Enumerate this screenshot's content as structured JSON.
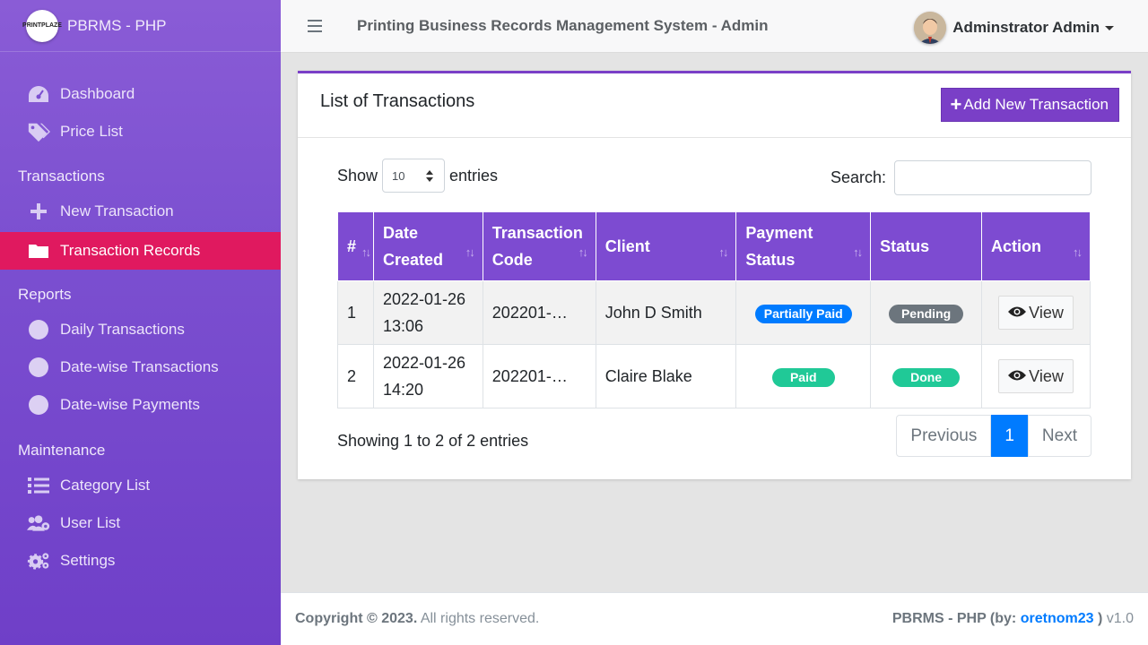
{
  "brand": {
    "name": "PBRMS - PHP",
    "logo_text": "PRINTPLAZE"
  },
  "sidebar": {
    "items": [
      {
        "label": "Dashboard",
        "icon": "tachometer-icon"
      },
      {
        "label": "Price List",
        "icon": "tags-icon"
      }
    ],
    "transactions_header": "Transactions",
    "transactions": [
      {
        "label": "New Transaction",
        "icon": "plus-icon"
      },
      {
        "label": "Transaction Records",
        "icon": "folder-icon",
        "active": true
      }
    ],
    "reports_header": "Reports",
    "reports": [
      {
        "label": "Daily Transactions",
        "icon": "circle-icon"
      },
      {
        "label": "Date-wise Transactions",
        "icon": "circle-icon"
      },
      {
        "label": "Date-wise Payments",
        "icon": "circle-icon"
      }
    ],
    "maintenance_header": "Maintenance",
    "maintenance": [
      {
        "label": "Category List",
        "icon": "list-icon"
      },
      {
        "label": "User List",
        "icon": "users-cog-icon"
      },
      {
        "label": "Settings",
        "icon": "cogs-icon"
      }
    ]
  },
  "topbar": {
    "title": "Printing Business Records Management System - Admin",
    "user_name": "Adminstrator Admin"
  },
  "card": {
    "title": "List of Transactions",
    "add_button": "Add New Transaction",
    "show_label": "Show",
    "entries_value": "10",
    "entries_label": "entries",
    "search_label": "Search:",
    "search_value": ""
  },
  "table": {
    "headers": [
      "#",
      "Date Created",
      "Transaction Code",
      "Client",
      "Payment Status",
      "Status",
      "Action"
    ],
    "rows": [
      {
        "num": "1",
        "date": "2022-01-26",
        "time": "13:06",
        "code": "202201-…",
        "client": "John D Smith",
        "payment": "Partially Paid",
        "status": "Pending",
        "action": "View"
      },
      {
        "num": "2",
        "date": "2022-01-26",
        "time": "14:20",
        "code": "202201-…",
        "client": "Claire Blake",
        "payment": "Paid",
        "status": "Done",
        "action": "View"
      }
    ]
  },
  "info": "Showing 1 to 2 of 2 entries",
  "pager": {
    "prev": "Previous",
    "current": "1",
    "next": "Next"
  },
  "footer": {
    "copyright": "Copyright © 2023.",
    "rights": "All rights reserved.",
    "app": "PBRMS - PHP (by:",
    "author": "oretnom23",
    "close": ")",
    "version": "v1.0"
  },
  "colors": {
    "sidebar": "#7b4fd0",
    "active": "#e0195f",
    "accent": "#7a3fc7",
    "primary": "#007bff"
  }
}
